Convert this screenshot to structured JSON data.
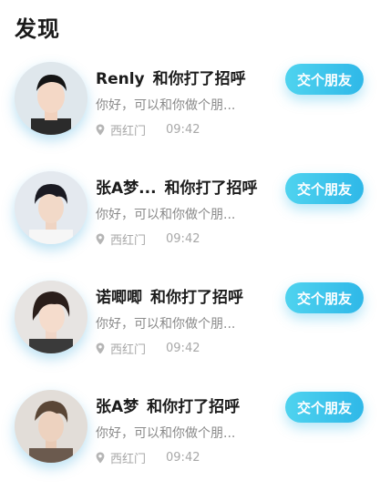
{
  "header": {
    "title": "发现"
  },
  "friends": [
    {
      "name": "Renly",
      "action": "和你打了招呼",
      "message": "你好，可以和你做个朋...",
      "location": "西红门",
      "time": "09:42",
      "button": "交个朋友"
    },
    {
      "name": "张A梦...",
      "action": "和你打了招呼",
      "message": "你好，可以和你做个朋...",
      "location": "西红门",
      "time": "09:42",
      "button": "交个朋友"
    },
    {
      "name": "诺唧唧",
      "action": "和你打了招呼",
      "message": "你好，可以和你做个朋...",
      "location": "西红门",
      "time": "09:42",
      "button": "交个朋友"
    },
    {
      "name": "张A梦",
      "action": "和你打了招呼",
      "message": "你好，可以和你做个朋...",
      "location": "西红门",
      "time": "09:42",
      "button": "交个朋友"
    }
  ],
  "colors": {
    "accent": "#2fb8e8",
    "accent_light": "#4fd3ef",
    "muted_text": "#8a8a8a"
  },
  "icons": {
    "location": "location-pin-icon"
  }
}
